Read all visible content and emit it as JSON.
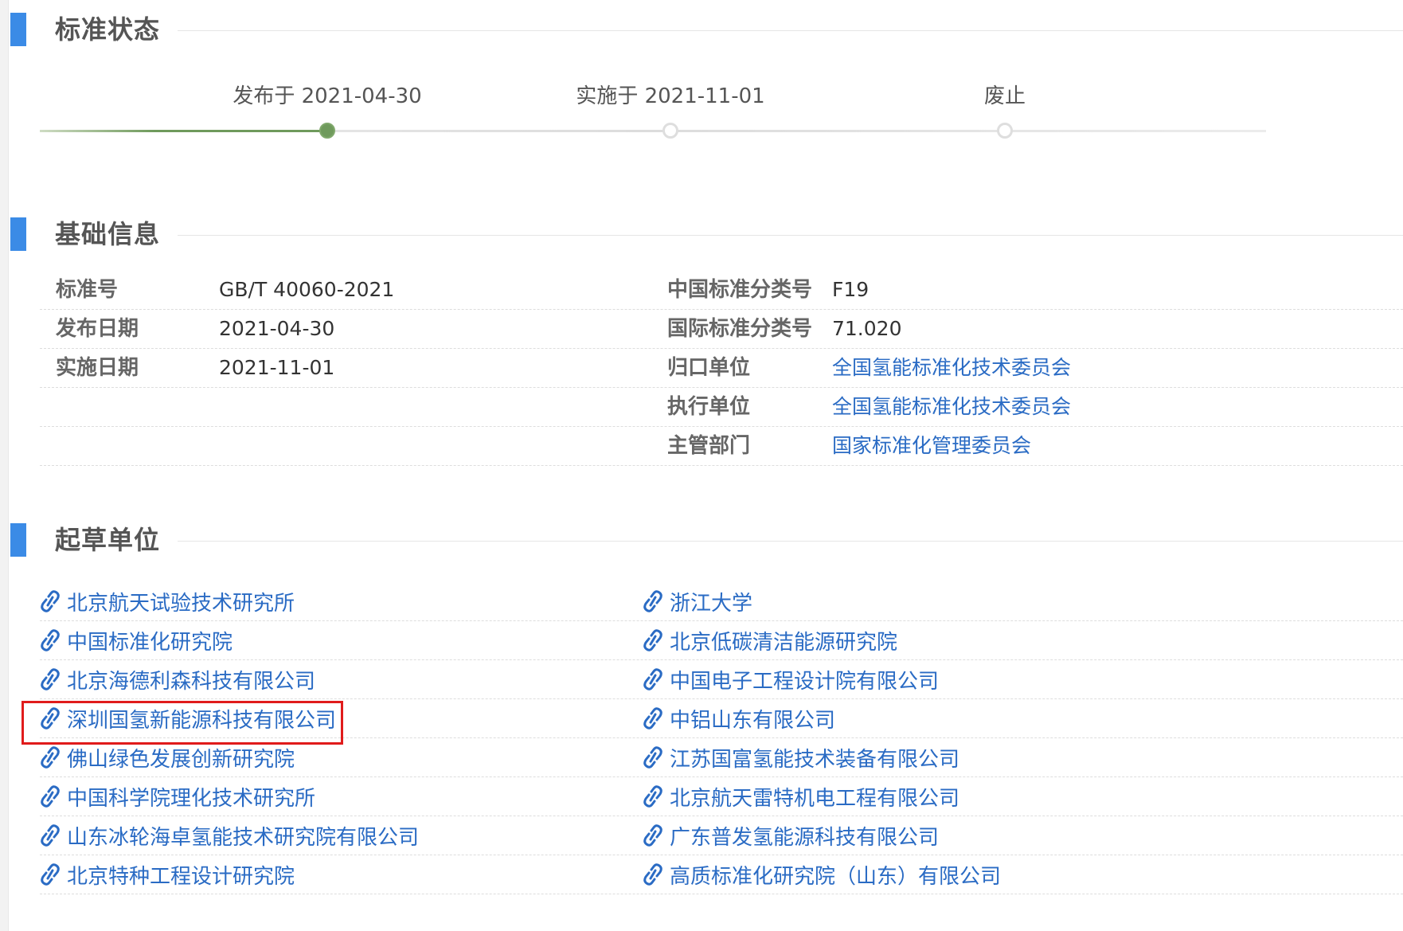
{
  "sections": {
    "status": "标准状态",
    "basic": "基础信息",
    "drafters": "起草单位"
  },
  "timeline": {
    "progress": 0.25,
    "steps": [
      {
        "label": "发布于 2021-04-30",
        "state": "done"
      },
      {
        "label": "实施于 2021-11-01",
        "state": "todo"
      },
      {
        "label": "废止",
        "state": "todo"
      }
    ]
  },
  "info": {
    "left": [
      {
        "label": "标准号",
        "value": "GB/T 40060-2021"
      },
      {
        "label": "发布日期",
        "value": "2021-04-30"
      },
      {
        "label": "实施日期",
        "value": "2021-11-01"
      }
    ],
    "right": [
      {
        "label": "中国标准分类号",
        "value": "F19",
        "link": false
      },
      {
        "label": "国际标准分类号",
        "value": "71.020",
        "link": false
      },
      {
        "label": "归口单位",
        "value": "全国氢能标准化技术委员会",
        "link": true
      },
      {
        "label": "执行单位",
        "value": "全国氢能标准化技术委员会",
        "link": true
      },
      {
        "label": "主管部门",
        "value": "国家标准化管理委员会",
        "link": true
      }
    ]
  },
  "drafters": {
    "left": [
      "北京航天试验技术研究所",
      "中国标准化研究院",
      "北京海德利森科技有限公司",
      "深圳国氢新能源科技有限公司",
      "佛山绿色发展创新研究院",
      "中国科学院理化技术研究所",
      "山东冰轮海卓氢能技术研究院有限公司",
      "北京特种工程设计研究院"
    ],
    "right": [
      "浙江大学",
      "北京低碳清洁能源研究院",
      "中国电子工程设计院有限公司",
      "中铝山东有限公司",
      "江苏国富氢能技术装备有限公司",
      "北京航天雷特机电工程有限公司",
      "广东普发氢能源科技有限公司",
      "高质标准化研究院（山东）有限公司"
    ],
    "highlighted": "深圳国氢新能源科技有限公司",
    "icon": "link-icon"
  },
  "colors": {
    "accent": "#3b8be6",
    "link": "#2a6bc4",
    "progress": "#6f9a5c",
    "highlight": "#e01b1b"
  }
}
